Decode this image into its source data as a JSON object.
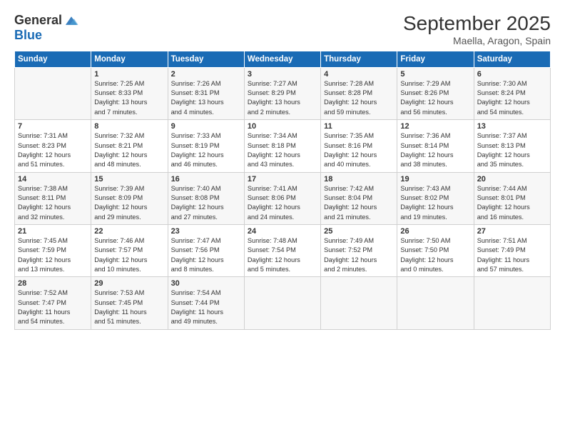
{
  "logo": {
    "general": "General",
    "blue": "Blue"
  },
  "title": "September 2025",
  "subtitle": "Maella, Aragon, Spain",
  "headers": [
    "Sunday",
    "Monday",
    "Tuesday",
    "Wednesday",
    "Thursday",
    "Friday",
    "Saturday"
  ],
  "weeks": [
    [
      {
        "day": "",
        "info": ""
      },
      {
        "day": "1",
        "info": "Sunrise: 7:25 AM\nSunset: 8:33 PM\nDaylight: 13 hours\nand 7 minutes."
      },
      {
        "day": "2",
        "info": "Sunrise: 7:26 AM\nSunset: 8:31 PM\nDaylight: 13 hours\nand 4 minutes."
      },
      {
        "day": "3",
        "info": "Sunrise: 7:27 AM\nSunset: 8:29 PM\nDaylight: 13 hours\nand 2 minutes."
      },
      {
        "day": "4",
        "info": "Sunrise: 7:28 AM\nSunset: 8:28 PM\nDaylight: 12 hours\nand 59 minutes."
      },
      {
        "day": "5",
        "info": "Sunrise: 7:29 AM\nSunset: 8:26 PM\nDaylight: 12 hours\nand 56 minutes."
      },
      {
        "day": "6",
        "info": "Sunrise: 7:30 AM\nSunset: 8:24 PM\nDaylight: 12 hours\nand 54 minutes."
      }
    ],
    [
      {
        "day": "7",
        "info": "Sunrise: 7:31 AM\nSunset: 8:23 PM\nDaylight: 12 hours\nand 51 minutes."
      },
      {
        "day": "8",
        "info": "Sunrise: 7:32 AM\nSunset: 8:21 PM\nDaylight: 12 hours\nand 48 minutes."
      },
      {
        "day": "9",
        "info": "Sunrise: 7:33 AM\nSunset: 8:19 PM\nDaylight: 12 hours\nand 46 minutes."
      },
      {
        "day": "10",
        "info": "Sunrise: 7:34 AM\nSunset: 8:18 PM\nDaylight: 12 hours\nand 43 minutes."
      },
      {
        "day": "11",
        "info": "Sunrise: 7:35 AM\nSunset: 8:16 PM\nDaylight: 12 hours\nand 40 minutes."
      },
      {
        "day": "12",
        "info": "Sunrise: 7:36 AM\nSunset: 8:14 PM\nDaylight: 12 hours\nand 38 minutes."
      },
      {
        "day": "13",
        "info": "Sunrise: 7:37 AM\nSunset: 8:13 PM\nDaylight: 12 hours\nand 35 minutes."
      }
    ],
    [
      {
        "day": "14",
        "info": "Sunrise: 7:38 AM\nSunset: 8:11 PM\nDaylight: 12 hours\nand 32 minutes."
      },
      {
        "day": "15",
        "info": "Sunrise: 7:39 AM\nSunset: 8:09 PM\nDaylight: 12 hours\nand 29 minutes."
      },
      {
        "day": "16",
        "info": "Sunrise: 7:40 AM\nSunset: 8:08 PM\nDaylight: 12 hours\nand 27 minutes."
      },
      {
        "day": "17",
        "info": "Sunrise: 7:41 AM\nSunset: 8:06 PM\nDaylight: 12 hours\nand 24 minutes."
      },
      {
        "day": "18",
        "info": "Sunrise: 7:42 AM\nSunset: 8:04 PM\nDaylight: 12 hours\nand 21 minutes."
      },
      {
        "day": "19",
        "info": "Sunrise: 7:43 AM\nSunset: 8:02 PM\nDaylight: 12 hours\nand 19 minutes."
      },
      {
        "day": "20",
        "info": "Sunrise: 7:44 AM\nSunset: 8:01 PM\nDaylight: 12 hours\nand 16 minutes."
      }
    ],
    [
      {
        "day": "21",
        "info": "Sunrise: 7:45 AM\nSunset: 7:59 PM\nDaylight: 12 hours\nand 13 minutes."
      },
      {
        "day": "22",
        "info": "Sunrise: 7:46 AM\nSunset: 7:57 PM\nDaylight: 12 hours\nand 10 minutes."
      },
      {
        "day": "23",
        "info": "Sunrise: 7:47 AM\nSunset: 7:56 PM\nDaylight: 12 hours\nand 8 minutes."
      },
      {
        "day": "24",
        "info": "Sunrise: 7:48 AM\nSunset: 7:54 PM\nDaylight: 12 hours\nand 5 minutes."
      },
      {
        "day": "25",
        "info": "Sunrise: 7:49 AM\nSunset: 7:52 PM\nDaylight: 12 hours\nand 2 minutes."
      },
      {
        "day": "26",
        "info": "Sunrise: 7:50 AM\nSunset: 7:50 PM\nDaylight: 12 hours\nand 0 minutes."
      },
      {
        "day": "27",
        "info": "Sunrise: 7:51 AM\nSunset: 7:49 PM\nDaylight: 11 hours\nand 57 minutes."
      }
    ],
    [
      {
        "day": "28",
        "info": "Sunrise: 7:52 AM\nSunset: 7:47 PM\nDaylight: 11 hours\nand 54 minutes."
      },
      {
        "day": "29",
        "info": "Sunrise: 7:53 AM\nSunset: 7:45 PM\nDaylight: 11 hours\nand 51 minutes."
      },
      {
        "day": "30",
        "info": "Sunrise: 7:54 AM\nSunset: 7:44 PM\nDaylight: 11 hours\nand 49 minutes."
      },
      {
        "day": "",
        "info": ""
      },
      {
        "day": "",
        "info": ""
      },
      {
        "day": "",
        "info": ""
      },
      {
        "day": "",
        "info": ""
      }
    ]
  ]
}
